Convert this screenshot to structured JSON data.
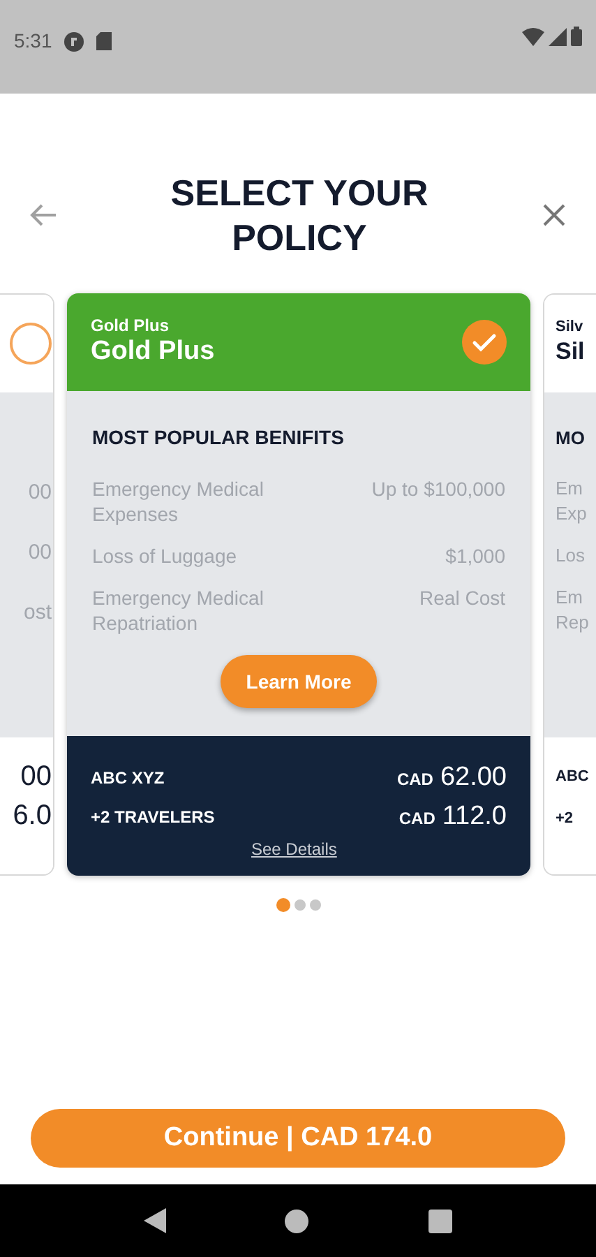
{
  "status_bar": {
    "time": "5:31"
  },
  "header": {
    "title": "SELECT YOUR POLICY"
  },
  "left_card": {
    "selected": false,
    "benefit_values": [
      "00",
      "00",
      "ost"
    ],
    "prices": [
      "00",
      "6.0"
    ]
  },
  "main_card": {
    "subtitle": "Gold Plus",
    "name": "Gold Plus",
    "selected": true,
    "section_title": "MOST POPULAR BENIFITS",
    "benefits": [
      {
        "label": "Emergency Medical Expenses",
        "value": "Up to $100,000"
      },
      {
        "label": "Loss of Luggage",
        "value": "$1,000"
      },
      {
        "label": "Emergency Medical Repatriation",
        "value": "Real Cost"
      }
    ],
    "learn_more": "Learn More",
    "footer_rows": [
      {
        "label": "ABC XYZ",
        "currency": "CAD",
        "amount": "62.00"
      },
      {
        "label": "+2 TRAVELERS",
        "currency": "CAD",
        "amount": "112.0"
      }
    ],
    "see_details": "See Details"
  },
  "right_card": {
    "subtitle": "Silv",
    "name": "Sil",
    "section_title": "MO",
    "benefit_labels": [
      [
        "Em",
        "Exp"
      ],
      [
        "Los"
      ],
      [
        "Em",
        "Rep"
      ]
    ],
    "footer_labels": [
      "ABC",
      "+2"
    ]
  },
  "pager": [
    {
      "selected": true
    },
    {
      "selected": false
    },
    {
      "selected": false
    }
  ],
  "continue_button": "Continue | CAD 174.0"
}
